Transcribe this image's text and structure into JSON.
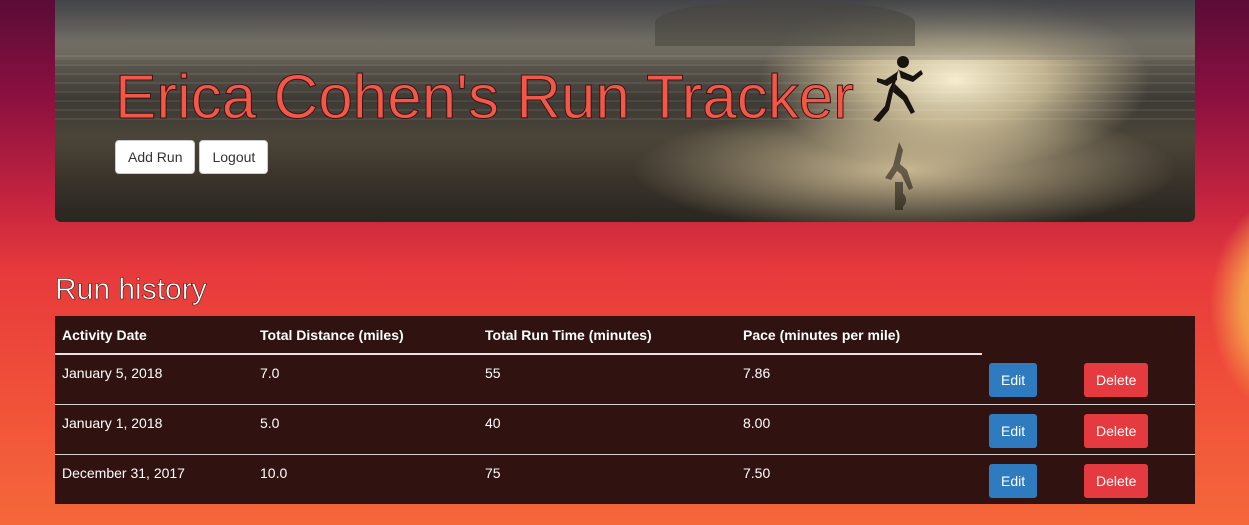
{
  "header": {
    "title": "Erica Cohen's Run Tracker",
    "buttons": {
      "add_run": "Add Run",
      "logout": "Logout"
    }
  },
  "main": {
    "section_title": "Run history",
    "table": {
      "columns": [
        "Activity Date",
        "Total Distance (miles)",
        "Total Run Time (minutes)",
        "Pace (minutes per mile)"
      ],
      "rows": [
        {
          "date": "January 5, 2018",
          "distance": "7.0",
          "time": "55",
          "pace": "7.86",
          "edit": "Edit",
          "delete": "Delete"
        },
        {
          "date": "January 1, 2018",
          "distance": "5.0",
          "time": "40",
          "pace": "8.00",
          "edit": "Edit",
          "delete": "Delete"
        },
        {
          "date": "December 31, 2017",
          "distance": "10.0",
          "time": "75",
          "pace": "7.50",
          "edit": "Edit",
          "delete": "Delete"
        }
      ]
    }
  },
  "colors": {
    "title_text": "#f2574a",
    "table_bg": "#301310",
    "edit_button": "#2e7bc0",
    "delete_button": "#e53a3f"
  },
  "icons": {
    "hero_image": "beach-runner-image"
  }
}
